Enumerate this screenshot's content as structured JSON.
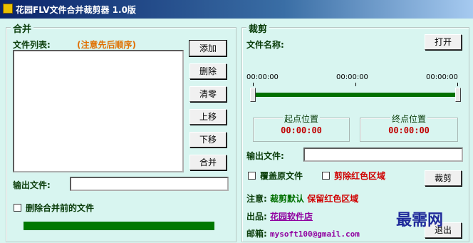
{
  "window": {
    "title": "花园FLV文件合并裁剪器 1.0版"
  },
  "merge": {
    "group_title": "合并",
    "file_list_label": "文件列表:",
    "file_list_note": "(注意先后顺序)",
    "buttons": {
      "add": "添加",
      "delete": "删除",
      "clear": "清零",
      "move_up": "上移",
      "move_down": "下移",
      "merge": "合并"
    },
    "output_label": "输出文件:",
    "output_value": "",
    "delete_checkbox_label": "删除合并前的文件",
    "delete_checked": false,
    "progress": 1.0
  },
  "cut": {
    "group_title": "裁剪",
    "filename_label": "文件名称:",
    "filename_value": "",
    "open_button": "打开",
    "time_left": "00:00:00",
    "time_mid": "00:00:00",
    "time_right": "00:00:00",
    "start_title": "起点位置",
    "start_value": "00:00:00",
    "end_title": "终点位置",
    "end_value": "00:00:00",
    "output_label": "输出文件:",
    "output_value": "",
    "overwrite_label": "覆盖原文件",
    "overwrite_checked": false,
    "cut_red_label": "剪除红色区域",
    "cut_red_checked": false,
    "cut_button": "裁剪",
    "note_label": "注意:",
    "note_default": "裁剪默认",
    "note_keep": "保留红色区域",
    "publisher_label": "出品:",
    "publisher_link": "花园软件店",
    "email_label": "邮箱:",
    "email_value": "mysoft100@gmail.com",
    "exit_button": "退出"
  },
  "watermark": "最需网",
  "colors": {
    "accent_green": "#007000",
    "warning_red": "#d00000",
    "note_orange": "#e07000",
    "link_purple": "#9000a0"
  }
}
